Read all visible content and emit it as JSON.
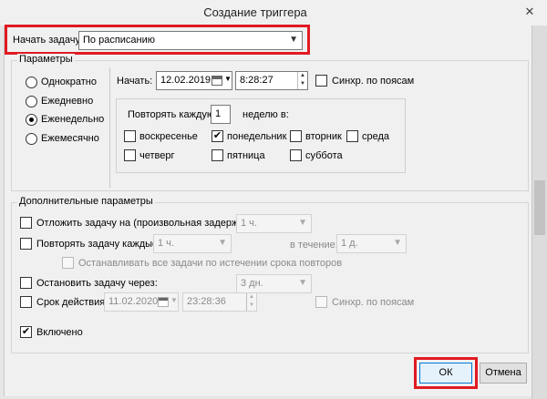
{
  "window": {
    "title": "Создание триггера",
    "close_glyph": "✕"
  },
  "begin_task": {
    "label": "Начать задачу:",
    "value": "По расписанию"
  },
  "params": {
    "legend": "Параметры",
    "schedule_options": [
      {
        "label": "Однократно",
        "selected": false
      },
      {
        "label": "Ежедневно",
        "selected": false
      },
      {
        "label": "Еженедельно",
        "selected": true
      },
      {
        "label": "Ежемесячно",
        "selected": false
      }
    ],
    "start_label": "Начать:",
    "start_date": "12.02.2019",
    "start_time": "8:28:27",
    "sync_label": "Синхр. по поясам",
    "repeat_every_label": "Повторять каждую",
    "repeat_every_value": "1",
    "week_label": "неделю в:",
    "days": [
      {
        "label": "воскресенье",
        "checked": false
      },
      {
        "label": "понедельник",
        "checked": true
      },
      {
        "label": "вторник",
        "checked": false
      },
      {
        "label": "среда",
        "checked": false
      },
      {
        "label": "четверг",
        "checked": false
      },
      {
        "label": "пятница",
        "checked": false
      },
      {
        "label": "суббота",
        "checked": false
      }
    ]
  },
  "advanced": {
    "legend": "Дополнительные параметры",
    "delay_label": "Отложить задачу на (произвольная задержка):",
    "delay_value": "1 ч.",
    "repeat_label": "Повторять задачу каждые:",
    "repeat_value": "1 ч.",
    "during_label": "в течение:",
    "during_value": "1 д.",
    "stop_all_label": "Останавливать все задачи по истечении срока повторов",
    "stop_after_label": "Остановить задачу через:",
    "stop_after_value": "3 дн.",
    "expire_label": "Срок действия:",
    "expire_date": "11.02.2020",
    "expire_time": "23:28:36",
    "expire_sync_label": "Синхр. по поясам",
    "enabled_label": "Включено"
  },
  "buttons": {
    "ok": "ОК",
    "cancel": "Отмена"
  },
  "highlight_color": "#e11a22"
}
